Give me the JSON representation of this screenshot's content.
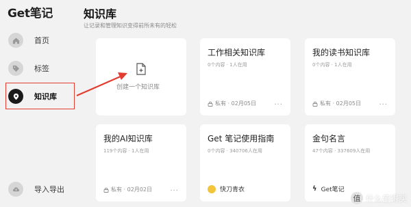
{
  "app": {
    "logo": "Get笔记"
  },
  "sidebar": {
    "items": [
      {
        "label": "首页",
        "icon": "home-icon"
      },
      {
        "label": "标签",
        "icon": "tag-icon"
      },
      {
        "label": "知识库",
        "icon": "knowledge-base-icon",
        "active": true
      },
      {
        "label": "导入导出",
        "icon": "cloud-upload-icon"
      }
    ]
  },
  "header": {
    "title": "知识库",
    "subtitle": "让记录和管理知识变得前所未有的轻松"
  },
  "create_card": {
    "label": "创建一个知识库",
    "icon": "new-file-icon"
  },
  "cards": [
    {
      "title": "工作相关知识库",
      "stats": "0个内容 · 1人在用",
      "visibility": "私有",
      "date": "02月05日"
    },
    {
      "title": "我的读书知识库",
      "stats": "0个内容 · 1人在用",
      "visibility": "私有",
      "date": "02月05日"
    },
    {
      "title": "我的AI知识库",
      "stats": "119个内容 · 1人在用",
      "visibility": "私有",
      "date": "02月02日"
    },
    {
      "title": "Get 笔记使用指南",
      "stats": "0个内容 · 340706人在用",
      "author": "快刀青衣"
    },
    {
      "title": "金句名言",
      "stats": "47个内容 · 337609人在用",
      "author": "Get笔记"
    }
  ],
  "more_label": "···",
  "watermark": {
    "badge": "值",
    "text": "什么值得买"
  },
  "colors": {
    "highlight": "#e23b30",
    "background": "#f2f2f2",
    "card": "#ffffff",
    "active_icon": "#1a1a1a"
  }
}
